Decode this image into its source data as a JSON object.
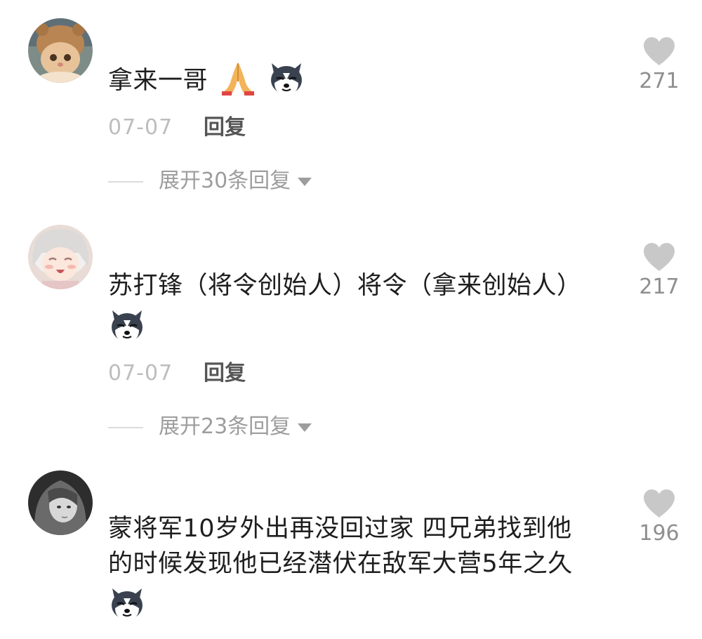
{
  "colors": {
    "heart": "#c8c8c8",
    "date": "#bdbdbd",
    "reply": "#555555",
    "expand": "#9d9d9d"
  },
  "comments": [
    {
      "text_lines": [
        "拿来一哥"
      ],
      "emojis": [
        "pray-hands-icon",
        "husky-dog-icon"
      ],
      "date": "07-07",
      "reply_label": "回复",
      "expand_label": "展开30条回复",
      "likes": "271",
      "avatar": "cat-avatar"
    },
    {
      "text_lines": [
        "苏打锋（将令创始人）将令（拿来创始人）"
      ],
      "emojis": [
        "husky-dog-icon"
      ],
      "date": "07-07",
      "reply_label": "回复",
      "expand_label": "展开23条回复",
      "likes": "217",
      "avatar": "anime-girl-avatar"
    },
    {
      "text_lines": [
        "蒙将军10岁外出再没回过家 四兄弟找到他",
        "的时候发现他已经潜伏在敌军大营5年之久"
      ],
      "emojis": [
        "husky-dog-icon"
      ],
      "likes": "196",
      "avatar": "dark-girl-avatar"
    }
  ]
}
